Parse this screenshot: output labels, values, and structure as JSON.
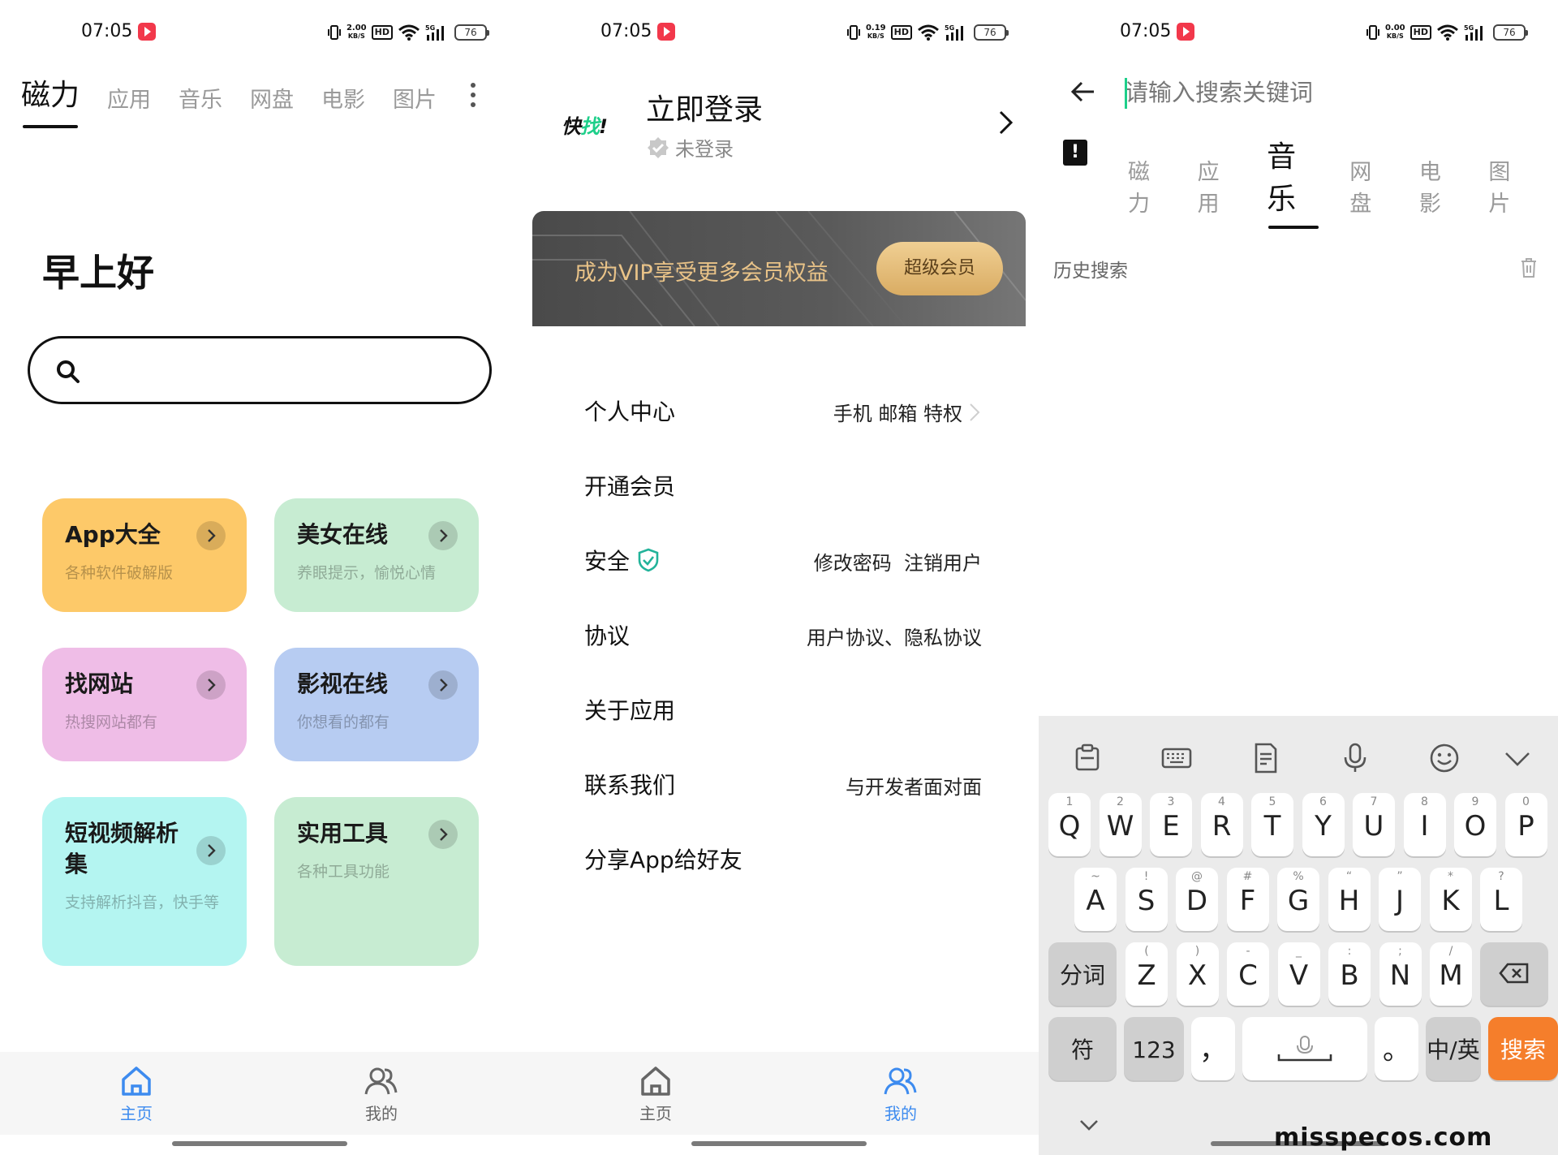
{
  "status_bar": {
    "time": "07:05",
    "battery": "76",
    "speed_p1": "2.00",
    "speed_p2": "0.19",
    "speed_p3": "0.00",
    "speed_unit": "KB/S",
    "hd": "HD"
  },
  "home": {
    "tabs": [
      "磁力",
      "应用",
      "音乐",
      "网盘",
      "电影",
      "图片"
    ],
    "active_tab": "磁力",
    "greeting": "早上好",
    "search_placeholder": "",
    "cards": [
      {
        "title": "App大全",
        "subtitle": "各种软件破解版",
        "color": "#fdc969"
      },
      {
        "title": "美女在线",
        "subtitle": "养眼提示，愉悦心情",
        "color": "#c7ecd2"
      },
      {
        "title": "找网站",
        "subtitle": "热搜网站都有",
        "color": "#efbde7"
      },
      {
        "title": "影视在线",
        "subtitle": "你想看的都有",
        "color": "#b7ccf2"
      },
      {
        "title": "短视频解析集",
        "subtitle": "支持解析抖音，快手等",
        "color": "#b4f5f1"
      },
      {
        "title": "实用工具",
        "subtitle": "各种工具功能",
        "color": "#c7ecd2"
      }
    ]
  },
  "nav": {
    "home": "主页",
    "mine": "我的",
    "active_color": "#3d8bef"
  },
  "profile": {
    "logo": "快找!",
    "login_title": "立即登录",
    "login_status": "未登录",
    "vip_text": "成为VIP享受更多会员权益",
    "vip_button": "超级会员",
    "menu": [
      {
        "label": "个人中心",
        "right": "手机 邮箱 特权"
      },
      {
        "label": "开通会员",
        "right": ""
      },
      {
        "label": "安全",
        "right": "修改密码  注销用户"
      },
      {
        "label": "协议",
        "right": "用户协议、隐私协议"
      },
      {
        "label": "关于应用",
        "right": ""
      },
      {
        "label": "联系我们",
        "right": "与开发者面对面"
      },
      {
        "label": "分享App给好友",
        "right": ""
      }
    ]
  },
  "search": {
    "placeholder": "请输入搜索关键词",
    "tabs": [
      "磁力",
      "应用",
      "音乐",
      "网盘",
      "电影",
      "图片"
    ],
    "active_tab": "音乐",
    "history_label": "历史搜索"
  },
  "keyboard": {
    "row1": [
      [
        "1",
        "Q"
      ],
      [
        "2",
        "W"
      ],
      [
        "3",
        "E"
      ],
      [
        "4",
        "R"
      ],
      [
        "5",
        "T"
      ],
      [
        "6",
        "Y"
      ],
      [
        "7",
        "U"
      ],
      [
        "8",
        "I"
      ],
      [
        "9",
        "O"
      ],
      [
        "0",
        "P"
      ]
    ],
    "row2": [
      [
        "~",
        "A"
      ],
      [
        "!",
        "S"
      ],
      [
        "@",
        "D"
      ],
      [
        "#",
        "F"
      ],
      [
        "%",
        "G"
      ],
      [
        "“",
        "H"
      ],
      [
        "”",
        "J"
      ],
      [
        "*",
        "K"
      ],
      [
        "?",
        "L"
      ]
    ],
    "row3": [
      [
        "(",
        "Z"
      ],
      [
        ")",
        "X"
      ],
      [
        "-",
        "C"
      ],
      [
        "_",
        "V"
      ],
      [
        ":",
        "B"
      ],
      [
        ";",
        "N"
      ],
      [
        "/",
        "M"
      ]
    ],
    "fenci": "分词",
    "fu": "符",
    "num": "123",
    "comma": "，",
    "period": "。",
    "lang": "中/英",
    "search": "搜索",
    "accent": "#f57e2b"
  },
  "watermark": "misspecos.com"
}
